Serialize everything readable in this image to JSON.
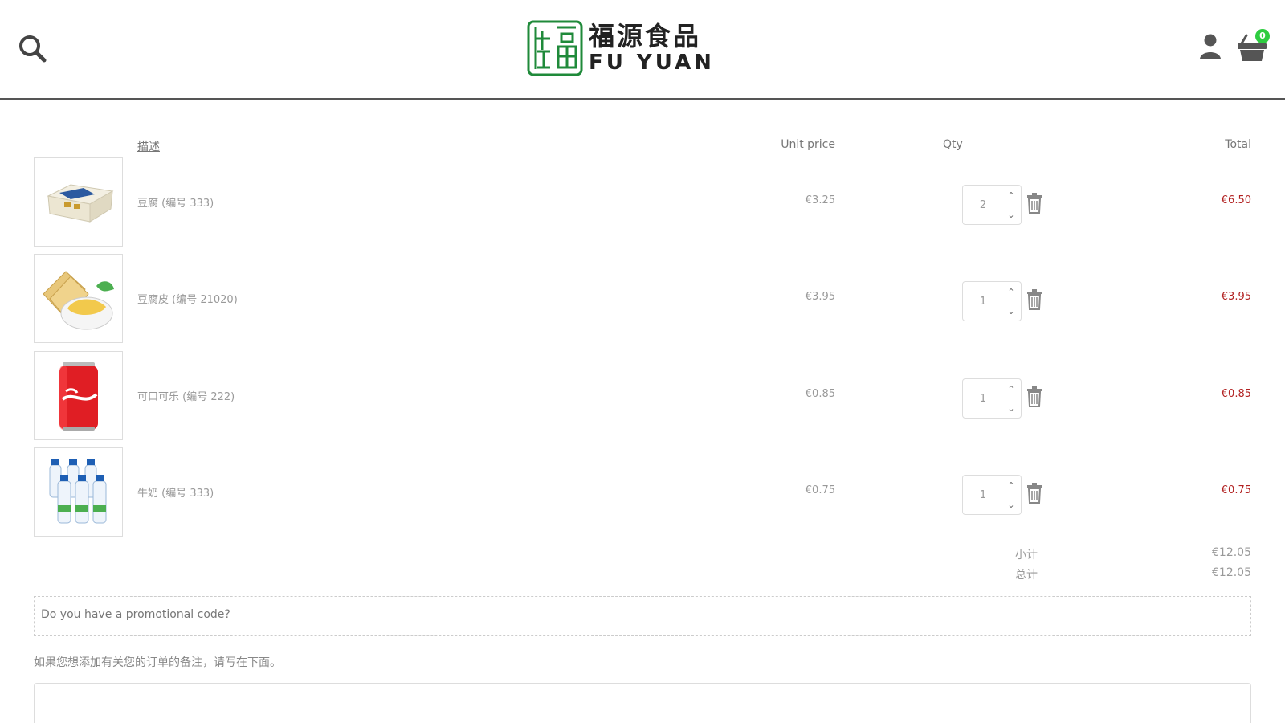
{
  "header": {
    "logo_cn": "福源食品",
    "logo_en": "FU YUAN",
    "cart_count": "0"
  },
  "columns": {
    "description": "描述",
    "unit_price": "Unit price",
    "qty": "Qty",
    "total": "Total"
  },
  "items": [
    {
      "name": "豆腐 (编号 333)",
      "unit_price": "€3.25",
      "qty": "2",
      "total": "€6.50",
      "image": "tofu-box"
    },
    {
      "name": "豆腐皮 (编号 21020)",
      "unit_price": "€3.95",
      "qty": "1",
      "total": "€3.95",
      "image": "tofu-skin"
    },
    {
      "name": "可口可乐 (编号 222)",
      "unit_price": "€0.85",
      "qty": "1",
      "total": "€0.85",
      "image": "cola-can"
    },
    {
      "name": "牛奶 (编号 333)",
      "unit_price": "€0.75",
      "qty": "1",
      "total": "€0.75",
      "image": "milk-bottles"
    }
  ],
  "summary": {
    "subtotal_label": "小计",
    "subtotal_value": "€12.05",
    "total_label": "总计",
    "total_value": "€12.05"
  },
  "promo": {
    "link_text": "Do you have a promotional code?"
  },
  "notes": {
    "label": "如果您想添加有关您的订单的备注，请写在下面。",
    "value": ""
  },
  "colors": {
    "price_red": "#b22222",
    "badge_green": "#2ecc40",
    "logo_green": "#1f8a3a"
  }
}
